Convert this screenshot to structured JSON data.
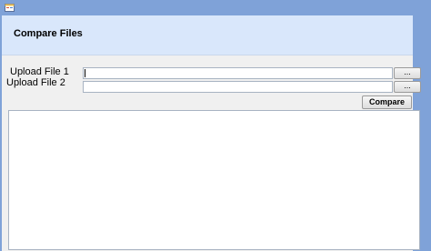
{
  "window": {
    "icon": "app-form-icon",
    "frame_color": "#7fa2d8"
  },
  "banner": {
    "title": "Compare Files",
    "background": "#d9e7fb"
  },
  "form": {
    "file1": {
      "label": "Upload File 1",
      "value": "",
      "browse_label": "..."
    },
    "file2": {
      "label": "Upload File 2",
      "value": "",
      "browse_label": "..."
    },
    "compare_label": "Compare"
  },
  "result": {
    "text": ""
  }
}
